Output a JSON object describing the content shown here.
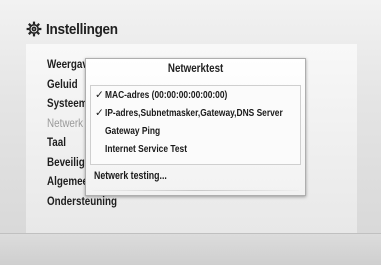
{
  "header": {
    "title": "Instellingen",
    "icon": "gear-icon"
  },
  "menu": {
    "items": [
      {
        "label": "Weergave",
        "active": false
      },
      {
        "label": "Geluid",
        "active": false
      },
      {
        "label": "Systeem",
        "active": false
      },
      {
        "label": "Netwerk",
        "active": true
      },
      {
        "label": "Taal",
        "active": false
      },
      {
        "label": "Beveiliging",
        "active": false
      },
      {
        "label": "Algemeen",
        "active": false
      },
      {
        "label": "Ondersteuning",
        "active": false
      }
    ]
  },
  "popup": {
    "title": "Netwerktest",
    "tests": [
      {
        "check": "✓",
        "label": "MAC-adres (00:00:00:00:00:00)"
      },
      {
        "check": "✓",
        "label": "IP-adres,Subnetmasker,Gateway,DNS Server"
      },
      {
        "check": "",
        "label": "Gateway Ping"
      },
      {
        "check": "",
        "label": "Internet Service Test"
      }
    ],
    "status": "Netwerk testing..."
  }
}
